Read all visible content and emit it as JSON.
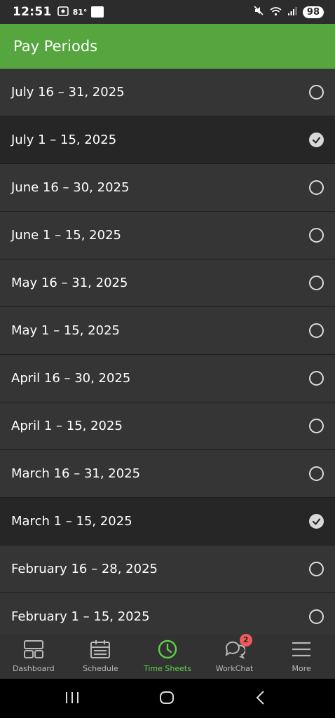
{
  "status_bar": {
    "time": "12:51",
    "temperature": "81°",
    "weather_badge": "The Weather Channel",
    "battery": "98",
    "icons": [
      "screenshot-icon",
      "weather-channel-icon",
      "mute-icon",
      "wifi-icon",
      "signal-icon"
    ]
  },
  "app_bar": {
    "title": "Pay Periods",
    "color": "#55a63f"
  },
  "pay_periods": [
    {
      "label": "July 16 – 31, 2025",
      "selected": false
    },
    {
      "label": "July 1 – 15, 2025",
      "selected": true
    },
    {
      "label": "June 16 – 30, 2025",
      "selected": false
    },
    {
      "label": "June 1 – 15, 2025",
      "selected": false
    },
    {
      "label": "May 16 – 31, 2025",
      "selected": false
    },
    {
      "label": "May 1 – 15, 2025",
      "selected": false
    },
    {
      "label": "April 16 – 30, 2025",
      "selected": false
    },
    {
      "label": "April 1 – 15, 2025",
      "selected": false
    },
    {
      "label": "March 16 – 31, 2025",
      "selected": false
    },
    {
      "label": "March 1 – 15, 2025",
      "selected": true
    },
    {
      "label": "February 16 – 28, 2025",
      "selected": false
    },
    {
      "label": "February 1 – 15, 2025",
      "selected": false
    }
  ],
  "bottom_nav": {
    "items": [
      {
        "label": "Dashboard",
        "icon": "dashboard-icon",
        "active": false
      },
      {
        "label": "Schedule",
        "icon": "calendar-icon",
        "active": false
      },
      {
        "label": "Time Sheets",
        "icon": "clock-icon",
        "active": true
      },
      {
        "label": "WorkChat",
        "icon": "chat-icon",
        "active": false,
        "badge": "2"
      },
      {
        "label": "More",
        "icon": "menu-icon",
        "active": false
      }
    ],
    "active_color": "#5fcf4a"
  },
  "system_nav": {
    "buttons": [
      "recents-button",
      "home-button",
      "back-button"
    ]
  }
}
